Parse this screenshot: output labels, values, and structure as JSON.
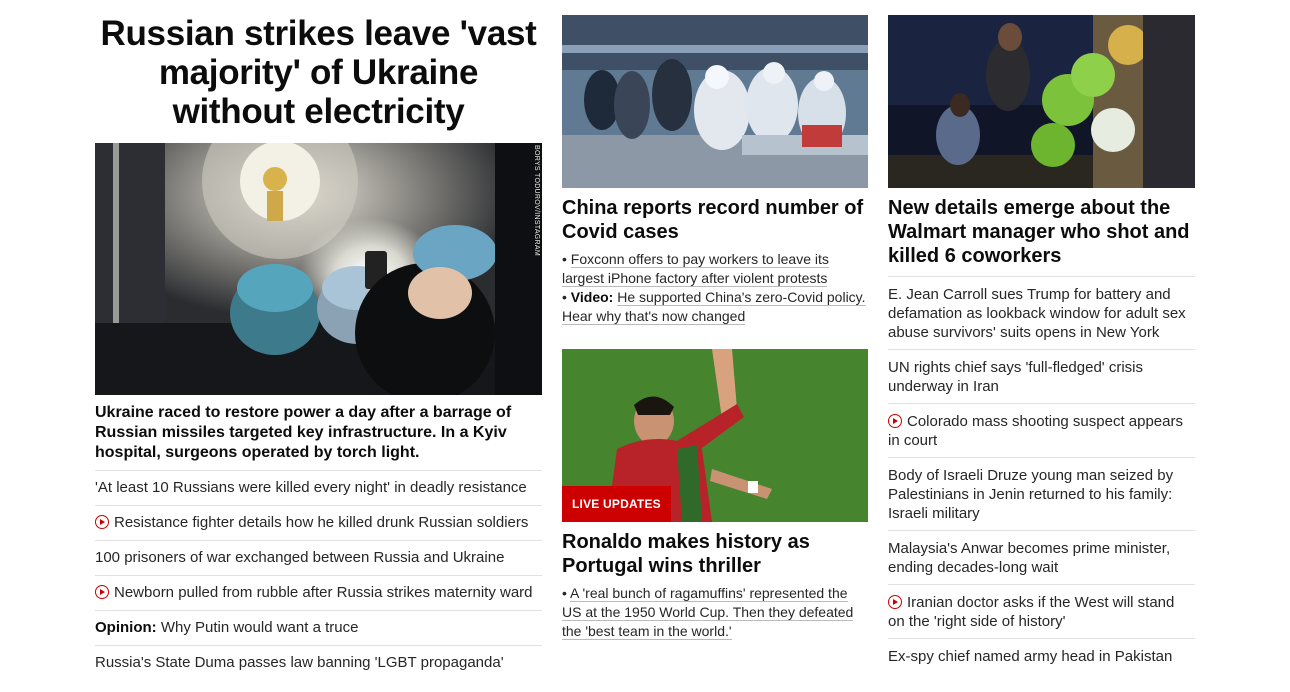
{
  "hero": {
    "headline": "Russian strikes leave 'vast majority' of Ukraine without electricity",
    "photo_credit": "BORYS TODUROV/INSTAGRAM",
    "lead": "Ukraine raced to restore power a day after a barrage of Russian missiles targeted key infrastructure. In a Kyiv hospital, surgeons operated by torch light.",
    "related": [
      {
        "text": "'At least 10 Russians were killed every night' in deadly resistance",
        "video": false,
        "kicker": ""
      },
      {
        "text": "Resistance fighter details how he killed drunk Russian soldiers",
        "video": true,
        "kicker": ""
      },
      {
        "text": "100 prisoners of war exchanged between Russia and Ukraine",
        "video": false,
        "kicker": ""
      },
      {
        "text": "Newborn pulled from rubble after Russia strikes maternity ward",
        "video": true,
        "kicker": ""
      },
      {
        "text": "Why Putin would want a truce",
        "video": false,
        "kicker": "Opinion:"
      },
      {
        "text": "Russia's State Duma passes law banning 'LGBT propaganda'",
        "video": false,
        "kicker": ""
      }
    ]
  },
  "china": {
    "title": "China reports record number of Covid cases",
    "bullet1": "Foxconn offers to pay workers to leave its largest iPhone factory after violent protests",
    "bullet2_kicker": "Video:",
    "bullet2": "He supported China's zero-Covid policy. Hear why that's now changed"
  },
  "ronaldo": {
    "badge": "LIVE UPDATES",
    "title": "Ronaldo makes history as Portugal wins thriller",
    "bullet1": "A 'real bunch of ragamuffins' represented the US at the 1950 World Cup. Then they defeated the 'best team in the world.'"
  },
  "walmart": {
    "title": "New details emerge about the Walmart manager who shot and killed 6 coworkers",
    "related": [
      {
        "text": "E. Jean Carroll sues Trump for battery and defamation as lookback window for adult sex abuse survivors' suits opens in New York",
        "video": false
      },
      {
        "text": "UN rights chief says 'full-fledged' crisis underway in Iran",
        "video": false
      },
      {
        "text": "Colorado mass shooting suspect appears in court",
        "video": true
      },
      {
        "text": "Body of Israeli Druze young man seized by Palestinians in Jenin returned to his family: Israeli military",
        "video": false
      },
      {
        "text": "Malaysia's Anwar becomes prime minister, ending decades-long wait",
        "video": false
      },
      {
        "text": "Iranian doctor asks if the West will stand on the 'right side of history'",
        "video": true
      },
      {
        "text": "Ex-spy chief named army head in Pakistan",
        "video": false
      }
    ]
  },
  "icons": {
    "video": "play-circle-icon"
  },
  "colors": {
    "accent": "#cc0000",
    "text": "#0c0c0c",
    "divider": "#e2e2e2"
  }
}
